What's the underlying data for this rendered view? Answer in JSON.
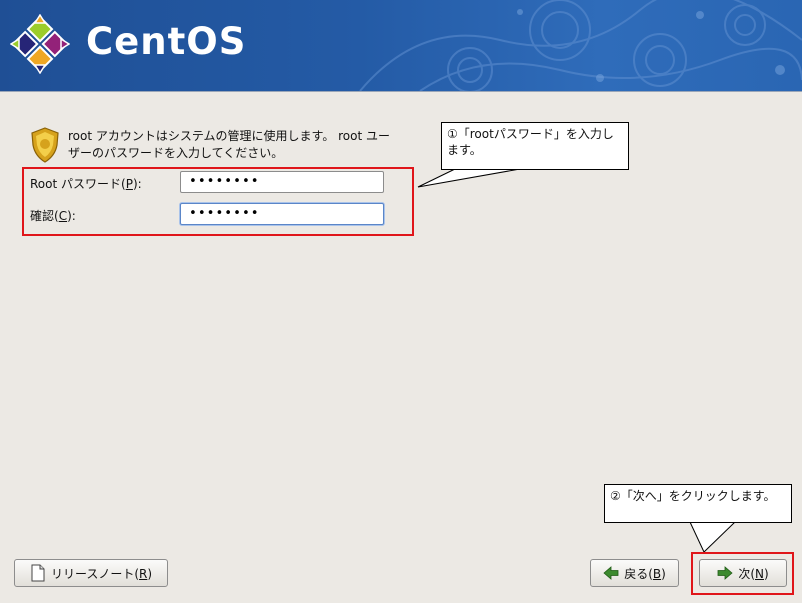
{
  "header": {
    "brand": "CentOS",
    "logo_icon": "centos-logo-icon"
  },
  "intro": {
    "text": "root アカウントはシステムの管理に使用します。 root ユーザーのパスワードを入力してください。",
    "icon": "shield-badge-icon"
  },
  "form": {
    "password": {
      "label_pre": "Root パスワード(",
      "mnemonic": "P",
      "label_post": "):",
      "value": "••••••••"
    },
    "confirm": {
      "label_pre": "確認(",
      "mnemonic": "C",
      "label_post": "):",
      "value": "••••••••"
    }
  },
  "callouts": {
    "first": "①「rootパスワード」を入力します。",
    "second": "②「次へ」をクリックします。"
  },
  "buttons": {
    "release_notes": {
      "pre": "リリースノート(",
      "mnemonic": "R",
      "post": ")",
      "icon": "document-icon"
    },
    "back": {
      "pre": "戻る(",
      "mnemonic": "B",
      "post": ")",
      "icon": "arrow-left-icon"
    },
    "next": {
      "pre": "次(",
      "mnemonic": "N",
      "post": ")",
      "icon": "arrow-right-icon"
    }
  },
  "colors": {
    "header_blue": "#245ba6",
    "highlight_red": "#e0161a",
    "arrow_green": "#3c8a2e"
  }
}
